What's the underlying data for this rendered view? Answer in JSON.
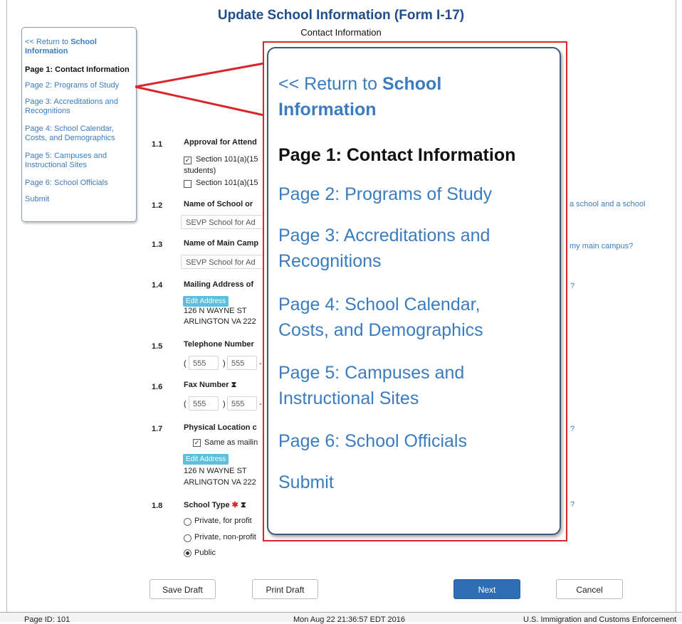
{
  "header": {
    "title": "Update School Information (Form I-17)",
    "subtitle": "Contact Information"
  },
  "nav": {
    "return_prefix": "<< Return to ",
    "return_bold_1": "School",
    "return_bold_2": "Information",
    "items": [
      {
        "label": "Page 1: Contact Information",
        "current": true
      },
      {
        "label": "Page 2: Programs of Study"
      },
      {
        "label_1": "Page 3: Accreditations and",
        "label_2": "Recognitions"
      },
      {
        "label_1": "Page 4: School Calendar,",
        "label_2": "Costs, and Demographics"
      },
      {
        "label_1": "Page 5: Campuses and",
        "label_2": "Instructional Sites"
      },
      {
        "label": "Page 6: School Officials"
      },
      {
        "label": "Submit"
      }
    ]
  },
  "form": {
    "q1_1": {
      "num": "1.1",
      "label": "Approval for Attend",
      "opt1": "Section 101(a)(15",
      "opt1_cont": "students)",
      "opt2": "Section 101(a)(15"
    },
    "q1_2": {
      "num": "1.2",
      "label": "Name of School or",
      "value": "SEVP School for Ad",
      "help": "a school and a school"
    },
    "q1_3": {
      "num": "1.3",
      "label": "Name of Main Camp",
      "value": "SEVP School for Ad",
      "help": "my main campus?"
    },
    "q1_4": {
      "num": "1.4",
      "label": "Mailing Address of",
      "edit": "Edit Address",
      "addr1": "126 N WAYNE ST",
      "addr2": "ARLINGTON VA 222",
      "help": "?"
    },
    "q1_5": {
      "num": "1.5",
      "label": "Telephone Number",
      "area": "555",
      "prefix": "555",
      "dash": "-"
    },
    "q1_6": {
      "num": "1.6",
      "label": "Fax Number",
      "hourglass": "⧗",
      "area": "555",
      "prefix": "555",
      "dash": "-"
    },
    "q1_7": {
      "num": "1.7",
      "label": "Physical Location c",
      "same": "Same as mailin",
      "edit": "Edit Address",
      "addr1": "126 N WAYNE ST",
      "addr2": "ARLINGTON VA 222",
      "help": "?"
    },
    "q1_8": {
      "num": "1.8",
      "label": "School Type",
      "required": "✱",
      "hourglass": "⧗",
      "opt1": "Private, for profit",
      "opt2": "Private, non-profit",
      "opt3": "Public",
      "help": "?"
    }
  },
  "buttons": {
    "save": "Save Draft",
    "print": "Print Draft",
    "next": "Next",
    "cancel": "Cancel"
  },
  "footer": {
    "page_id": "Page ID: 101",
    "timestamp": "Mon Aug 22 21:36:57 EDT 2016",
    "agency": "U.S. Immigration and Customs Enforcement"
  },
  "colors": {
    "accent": "#3b7cc0",
    "title": "#1f4e8c",
    "highlight": "#d9262b",
    "primary_button": "#2f6eb5"
  }
}
